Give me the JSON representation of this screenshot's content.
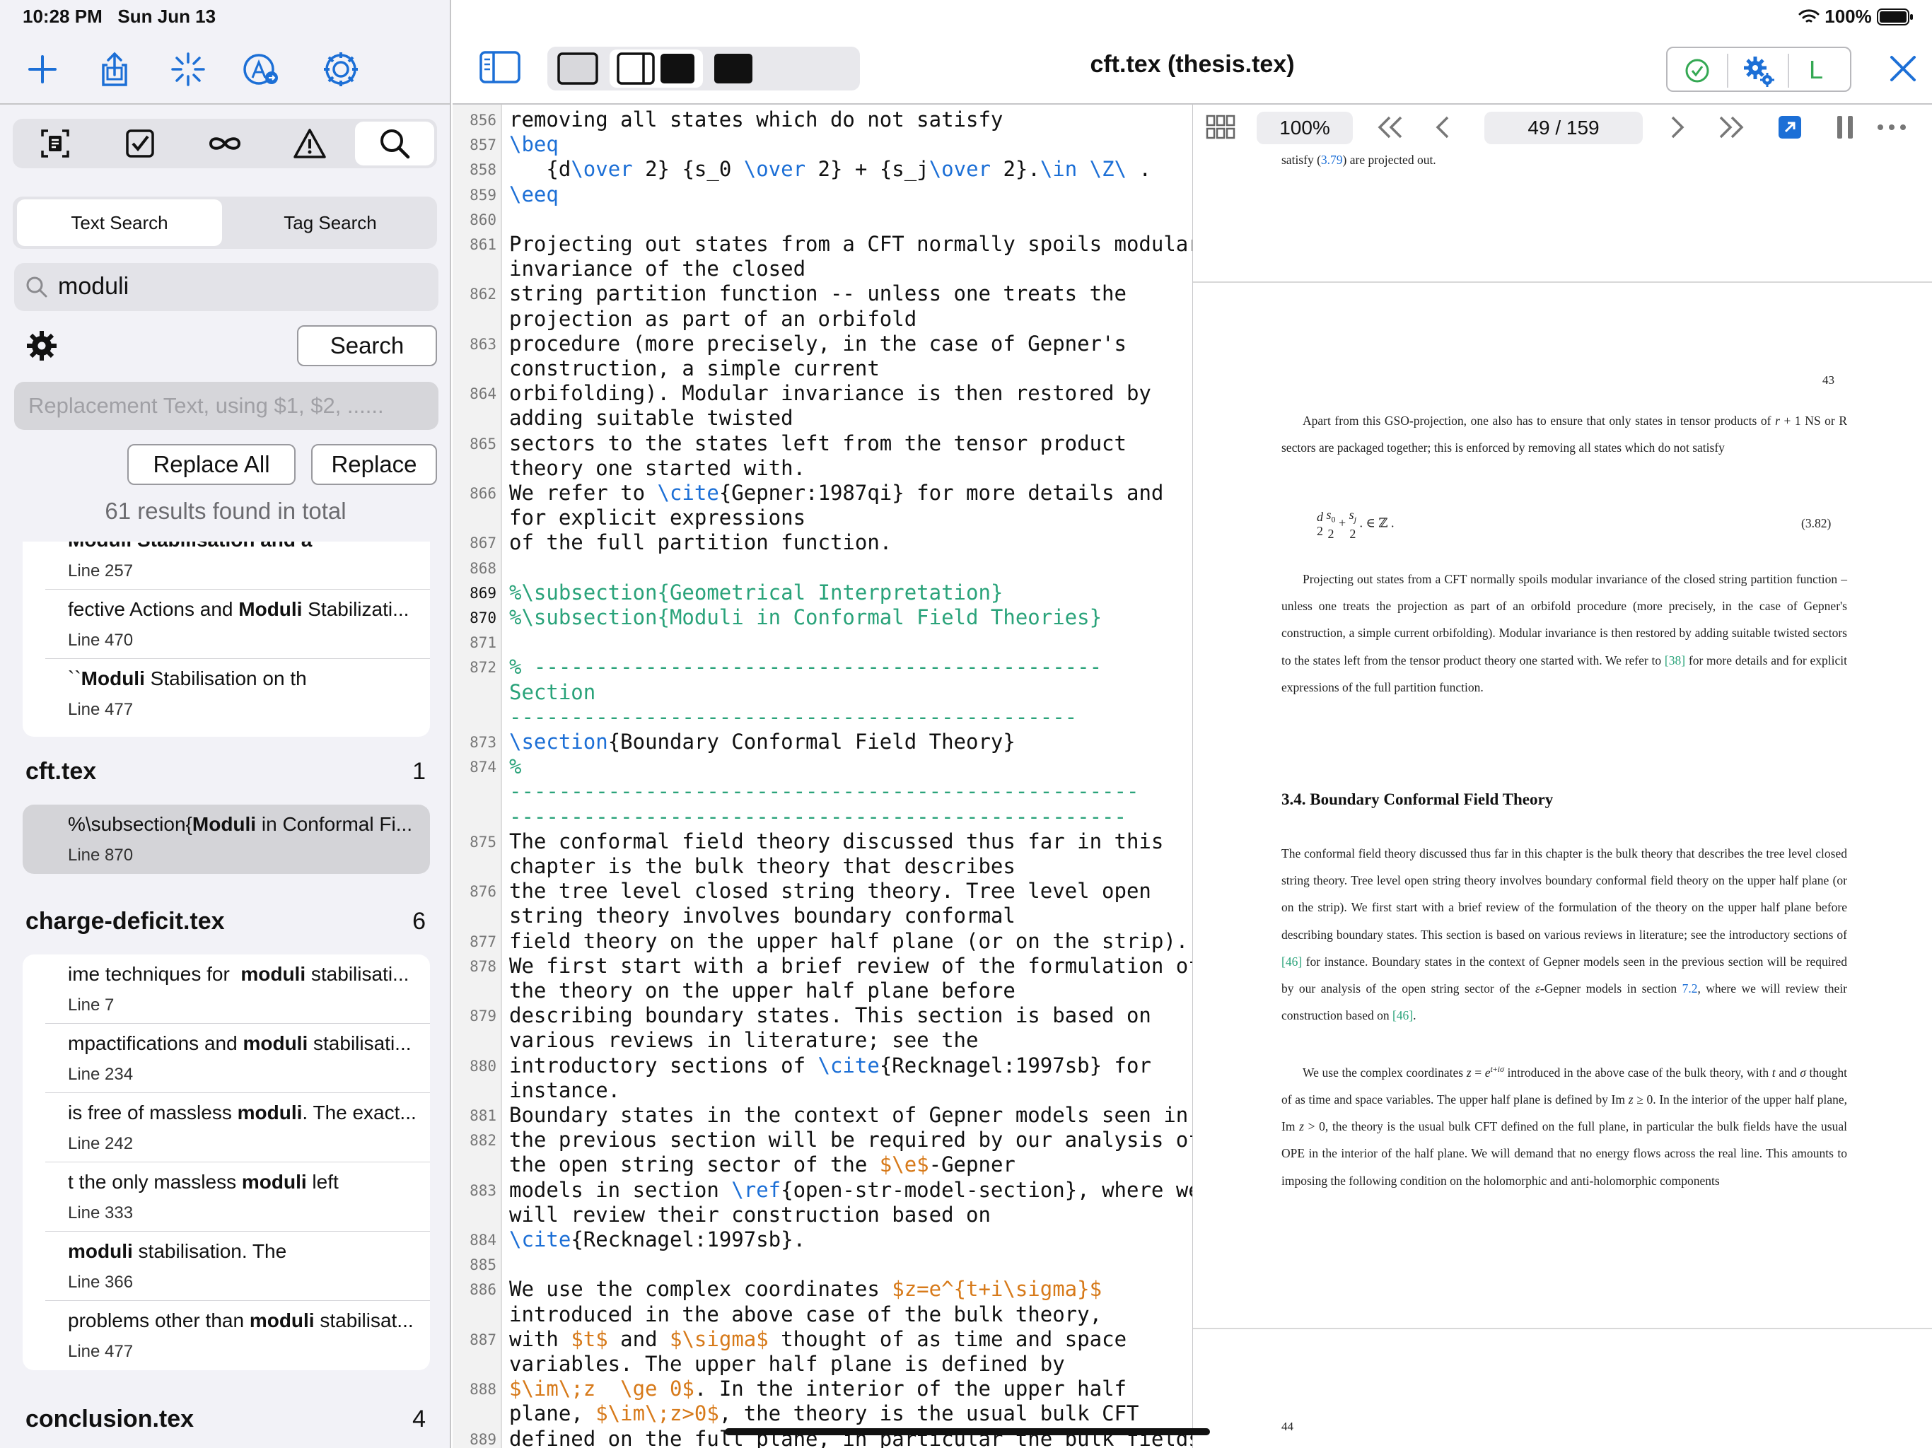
{
  "status": {
    "time": "10:28 PM",
    "date": "Sun Jun 13",
    "battery": "100%"
  },
  "toolbar": {
    "title": "cft.tex (thesis.tex)",
    "compile_label": "L"
  },
  "search": {
    "tabs": [
      {
        "label": "Text Search"
      },
      {
        "label": "Tag Search"
      }
    ],
    "query": "moduli",
    "search_button": "Search",
    "replace_placeholder": "Replacement Text, using $1, $2, ......",
    "replace_all_button": "Replace All",
    "replace_button": "Replace",
    "summary": "61 results found in total",
    "first_group_results": [
      {
        "text": "Moduli Stabilisation and a",
        "line": "Line 257"
      },
      {
        "pre": "fective Actions and ",
        "hit": "Moduli",
        "post": " Stabilizati...",
        "line": "Line 470"
      },
      {
        "pre": "``",
        "hit": "Moduli",
        "post": " Stabilisation on th",
        "line": "Line 477"
      }
    ],
    "groups": [
      {
        "file": "cft.tex",
        "count": "1",
        "results": [
          {
            "pre": "%\\subsection{",
            "hit": "Moduli",
            "post": " in Conformal Fi...",
            "line": "Line 870",
            "selected": true
          }
        ]
      },
      {
        "file": "charge-deficit.tex",
        "count": "6",
        "results": [
          {
            "pre": "ime techniques for  ",
            "hit": "moduli",
            "post": " stabilisati...",
            "line": "Line 7"
          },
          {
            "pre": "mpactifications and ",
            "hit": "moduli",
            "post": " stabilisati...",
            "line": "Line 234"
          },
          {
            "pre": "is free of massless ",
            "hit": "moduli",
            "post": ". The exact...",
            "line": "Line 242"
          },
          {
            "pre": "t the only massless ",
            "hit": "moduli",
            "post": " left",
            "line": "Line 333"
          },
          {
            "pre": "",
            "hit": "moduli",
            "post": " stabilisation. The",
            "line": "Line 366"
          },
          {
            "pre": "problems other than ",
            "hit": "moduli",
            "post": " stabilisat...",
            "line": "Line 477"
          }
        ]
      },
      {
        "file": "conclusion.tex",
        "count": "4",
        "results": []
      }
    ]
  },
  "editor": {
    "lines": [
      {
        "n": "856",
        "rows": [
          [
            [
              "removing all states which do not satisfy",
              ""
            ]
          ]
        ]
      },
      {
        "n": "857",
        "rows": [
          [
            [
              "\\beq",
              "k"
            ]
          ]
        ]
      },
      {
        "n": "858",
        "rows": [
          [
            [
              "   {d",
              ""
            ],
            [
              "\\over",
              "k"
            ],
            [
              " 2} {s_0 ",
              ""
            ],
            [
              "\\over",
              "k"
            ],
            [
              " 2} + {s_j",
              ""
            ],
            [
              "\\over",
              "k"
            ],
            [
              " 2}.",
              ""
            ],
            [
              "\\in \\Z\\",
              "k"
            ],
            [
              " .",
              ""
            ]
          ]
        ]
      },
      {
        "n": "859",
        "rows": [
          [
            [
              "\\eeq",
              "k"
            ]
          ]
        ]
      },
      {
        "n": "860",
        "rows": [
          [
            [
              "",
              ""
            ]
          ]
        ]
      },
      {
        "n": "861",
        "rows": [
          [
            [
              "Projecting out states from a CFT normally spoils modular",
              ""
            ]
          ],
          [
            [
              "invariance of the closed",
              ""
            ]
          ]
        ]
      },
      {
        "n": "862",
        "rows": [
          [
            [
              "string partition function -- unless one treats the",
              ""
            ]
          ],
          [
            [
              "projection as part of an orbifold",
              ""
            ]
          ]
        ]
      },
      {
        "n": "863",
        "rows": [
          [
            [
              "procedure (more precisely, in the case of Gepner's",
              ""
            ]
          ],
          [
            [
              "construction, a simple current",
              ""
            ]
          ]
        ]
      },
      {
        "n": "864",
        "rows": [
          [
            [
              "orbifolding). Modular invariance is then restored by",
              ""
            ]
          ],
          [
            [
              "adding suitable twisted",
              ""
            ]
          ]
        ]
      },
      {
        "n": "865",
        "rows": [
          [
            [
              "sectors to the states left from the tensor product",
              ""
            ]
          ],
          [
            [
              "theory one started with.",
              ""
            ]
          ]
        ]
      },
      {
        "n": "866",
        "rows": [
          [
            [
              "We refer to ",
              ""
            ],
            [
              "\\cite",
              "k"
            ],
            [
              "{Gepner:1987qi} for more details and",
              ""
            ]
          ],
          [
            [
              "for explicit expressions",
              ""
            ]
          ]
        ]
      },
      {
        "n": "867",
        "rows": [
          [
            [
              "of the full partition function.",
              ""
            ]
          ]
        ]
      },
      {
        "n": "868",
        "rows": [
          [
            [
              "",
              ""
            ]
          ]
        ]
      },
      {
        "n": "869",
        "rows": [
          [
            [
              "%\\subsection{Geometrical Interpretation}",
              "g"
            ]
          ]
        ]
      },
      {
        "n": "870",
        "rows": [
          [
            [
              "%\\subsection{Moduli in Conformal Field Theories}",
              "g"
            ]
          ]
        ]
      },
      {
        "n": "871",
        "rows": [
          [
            [
              "",
              ""
            ]
          ]
        ]
      },
      {
        "n": "872",
        "rows": [
          [
            [
              "% ----------------------------------------------",
              "g"
            ]
          ],
          [
            [
              "Section",
              "g"
            ]
          ],
          [
            [
              "----------------------------------------------",
              "g"
            ]
          ]
        ]
      },
      {
        "n": "873",
        "rows": [
          [
            [
              "\\section",
              "k"
            ],
            [
              "{Boundary Conformal Field Theory}",
              ""
            ]
          ]
        ]
      },
      {
        "n": "874",
        "rows": [
          [
            [
              "%",
              "g"
            ]
          ],
          [
            [
              "---------------------------------------------------",
              "g"
            ]
          ],
          [
            [
              "--------------------------------------------------",
              "g"
            ]
          ]
        ]
      },
      {
        "n": "875",
        "rows": [
          [
            [
              "The conformal field theory discussed thus far in this",
              ""
            ]
          ],
          [
            [
              "chapter is the bulk theory that describes",
              ""
            ]
          ]
        ]
      },
      {
        "n": "876",
        "rows": [
          [
            [
              "the tree level closed string theory. Tree level open",
              ""
            ]
          ],
          [
            [
              "string theory involves boundary conformal",
              ""
            ]
          ]
        ]
      },
      {
        "n": "877",
        "rows": [
          [
            [
              "field theory on the upper half plane (or on the strip).",
              ""
            ]
          ]
        ]
      },
      {
        "n": "878",
        "rows": [
          [
            [
              "We first start with a brief review of the formulation of",
              ""
            ]
          ],
          [
            [
              "the theory on the upper half plane before",
              ""
            ]
          ]
        ]
      },
      {
        "n": "879",
        "rows": [
          [
            [
              "describing boundary states. This section is based on",
              ""
            ]
          ],
          [
            [
              "various reviews in literature; see the",
              ""
            ]
          ]
        ]
      },
      {
        "n": "880",
        "rows": [
          [
            [
              "introductory sections of ",
              ""
            ],
            [
              "\\cite",
              "k"
            ],
            [
              "{Recknagel:1997sb} for",
              ""
            ]
          ],
          [
            [
              "instance.",
              ""
            ]
          ]
        ]
      },
      {
        "n": "881",
        "rows": [
          [
            [
              "Boundary states in the context of Gepner models seen in",
              ""
            ]
          ]
        ]
      },
      {
        "n": "882",
        "rows": [
          [
            [
              "the previous section will be required by our analysis of",
              ""
            ]
          ],
          [
            [
              "the open string sector of the ",
              ""
            ],
            [
              "$\\e$",
              "o"
            ],
            [
              "-Gepner",
              ""
            ]
          ]
        ]
      },
      {
        "n": "883",
        "rows": [
          [
            [
              "models in section ",
              ""
            ],
            [
              "\\ref",
              "k"
            ],
            [
              "{open-str-model-section}, where we",
              ""
            ]
          ],
          [
            [
              "will review their construction based on",
              ""
            ]
          ]
        ]
      },
      {
        "n": "884",
        "rows": [
          [
            [
              "\\cite",
              "k"
            ],
            [
              "{Recknagel:1997sb}.",
              ""
            ]
          ]
        ]
      },
      {
        "n": "885",
        "rows": [
          [
            [
              "",
              ""
            ]
          ]
        ]
      },
      {
        "n": "886",
        "rows": [
          [
            [
              "We use the complex coordinates ",
              ""
            ],
            [
              "$z=e^{t+i\\sigma}$",
              "o"
            ]
          ],
          [
            [
              "introduced in the above case of the bulk theory,",
              ""
            ]
          ]
        ]
      },
      {
        "n": "887",
        "rows": [
          [
            [
              "with ",
              ""
            ],
            [
              "$t$",
              "o"
            ],
            [
              " and ",
              ""
            ],
            [
              "$\\sigma$",
              "o"
            ],
            [
              " thought of as time and space",
              ""
            ]
          ],
          [
            [
              "variables. The upper half plane is defined by",
              ""
            ]
          ]
        ]
      },
      {
        "n": "888",
        "rows": [
          [
            [
              "$\\im\\;z  \\ge 0$",
              "o"
            ],
            [
              ". In the interior of the upper half",
              ""
            ]
          ],
          [
            [
              "plane, ",
              ""
            ],
            [
              "$\\im\\;z>0$",
              "o"
            ],
            [
              ", the theory is the usual bulk CFT",
              ""
            ]
          ]
        ]
      },
      {
        "n": "889",
        "rows": [
          [
            [
              "defined on the full plane, in particular the bulk fields",
              ""
            ]
          ]
        ]
      }
    ]
  },
  "pdf": {
    "zoom": "100%",
    "page_indicator": "49 / 159",
    "top_line": "satisfy (3.79) are projected out.",
    "page_number_1": "43",
    "para1": "Apart from this GSO-projection, one also has to ensure that only states in tensor products of r + 1 NS or R sectors are packaged together; this is enforced by removing all states which do not satisfy",
    "equation_label": "(3.82)",
    "para2": "Projecting out states from a CFT normally spoils modular invariance of the closed string partition function – unless one treats the projection as part of an orbifold procedure (more precisely, in the case of Gepner's construction, a simple current orbifolding). Modular invariance is then restored by adding suitable twisted sectors to the states left from the tensor product theory one started with. We refer to [38] for more details and for explicit expressions of the full partition function.",
    "section_heading": "3.4.  Boundary Conformal Field Theory",
    "para3": "The conformal field theory discussed thus far in this chapter is the bulk theory that describes the tree level closed string theory. Tree level open string theory involves boundary conformal field theory on the upper half plane (or on the strip). We first start with a brief review of the formulation of the theory on the upper half plane before describing boundary states. This section is based on various reviews in literature; see the introductory sections of [46] for instance. Boundary states in the context of Gepner models seen in the previous section will be required by our analysis of the open string sector of the ε-Gepner models in section 7.2, where we will review their construction based on [46].",
    "para4": "We use the complex coordinates z = e^{t+iσ} introduced in the above case of the bulk theory, with t and σ thought of as time and space variables. The upper half plane is defined by Im z ≥ 0. In the interior of the upper half plane, Im z > 0, the theory is the usual bulk CFT defined on the full plane, in particular the bulk fields have the usual OPE in the interior of the half plane. We will demand that no energy flows across the real line. This amounts to imposing the following condition on the holomorphic and anti-holomorphic components",
    "page_number_2": "44"
  },
  "colors": {
    "accent": "#1c6fd6",
    "comment": "#2aa37a",
    "math": "#d77a1a",
    "success": "#34a853"
  }
}
